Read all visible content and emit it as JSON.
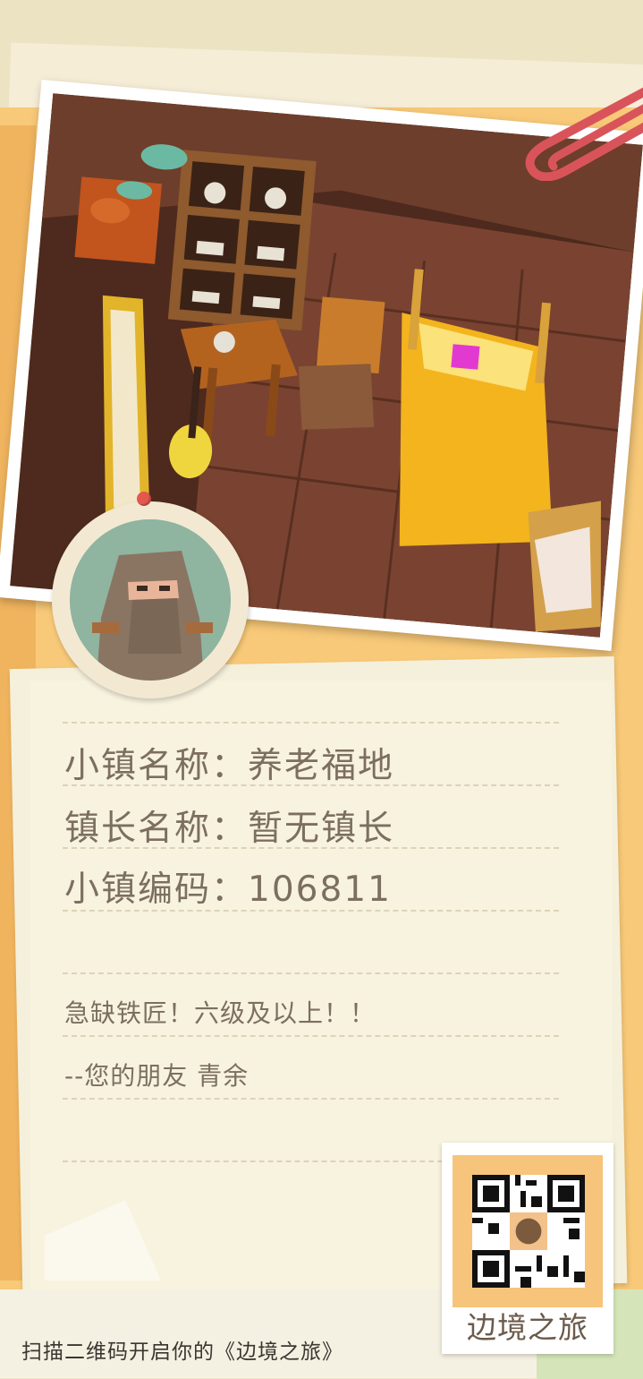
{
  "town": {
    "name_line": "小镇名称：养老福地",
    "mayor_line": "镇长名称：暂无镇长",
    "code_line": "小镇编码：106811"
  },
  "message": {
    "line1": "急缺铁匠！六级及以上！！",
    "line2": "--您的朋友 青余"
  },
  "footer": {
    "scan_text": "扫描二维码开启你的《边境之旅》"
  },
  "stamp": {
    "label": "边境之旅"
  },
  "colors": {
    "text": "#7c6f60",
    "orange_paper": "#f8c978",
    "note_paper": "#f5f0db",
    "clip": "#d9545a"
  }
}
